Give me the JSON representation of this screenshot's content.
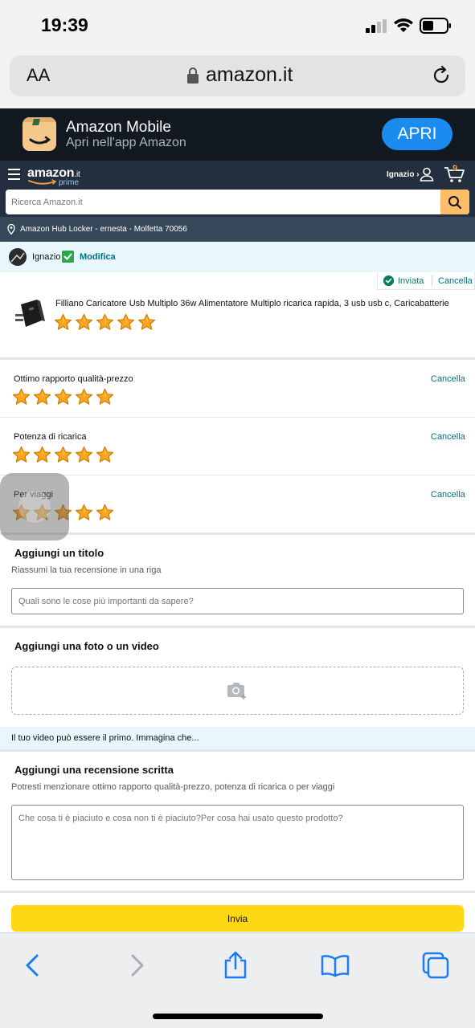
{
  "status_bar": {
    "time": "19:39"
  },
  "browser": {
    "text_size_label": "AA",
    "url": "amazon.it"
  },
  "app_banner": {
    "name": "Amazon Mobile",
    "subtitle": "Apri nell'app Amazon",
    "open_label": "APRI"
  },
  "header": {
    "logo_text": "amazon",
    "logo_tld": ".it",
    "logo_prime": "prime",
    "user_label": "Ignazio ›",
    "cart_count": "9",
    "search_placeholder": "Ricerca Amazon.it",
    "location": "Amazon Hub Locker - ernesta - Molfetta 70056"
  },
  "profile": {
    "name": "Ignazio",
    "edit_label": "Modifica"
  },
  "product": {
    "sent_label": "Inviata",
    "cancel_label": "Cancella",
    "title": "Filliano Caricatore Usb Multiplo 36w Alimentatore Multiplo ricarica rapida, 3 usb usb c, Caricabatterie",
    "rating": 5
  },
  "ratings": [
    {
      "label": "Ottimo rapporto qualità-prezzo",
      "cancel": "Cancella",
      "value": 5
    },
    {
      "label": "Potenza di ricarica",
      "cancel": "Cancella",
      "value": 5
    },
    {
      "label": "Per viaggi",
      "cancel": "Cancella",
      "value": 5
    }
  ],
  "title_section": {
    "heading": "Aggiungi un titolo",
    "hint": "Riassumi la tua recensione in una riga",
    "placeholder": "Quali sono le cose più importanti da sapere?"
  },
  "media_section": {
    "heading": "Aggiungi una foto o un video",
    "video_banner": "Il tuo video può essere il primo. Immagina che..."
  },
  "review_section": {
    "heading": "Aggiungi una recensione scritta",
    "hint": "Potresti menzionare ottimo rapporto qualità-prezzo, potenza di ricarica o per viaggi",
    "placeholder": "Che cosa ti è piaciuto e cosa non ti è piaciuto?Per cosa hai usato questo prodotto?"
  },
  "submit_label": "Invia",
  "colors": {
    "amazon_dark": "#131921",
    "amazon_header": "#232f3e",
    "amazon_link": "#007185",
    "star": "#ffa41c",
    "submit": "#ffd814",
    "ios_blue": "#1a7cf0"
  },
  "toolbar_icons": [
    "back-icon",
    "forward-icon",
    "share-icon",
    "bookmarks-icon",
    "tabs-icon"
  ]
}
